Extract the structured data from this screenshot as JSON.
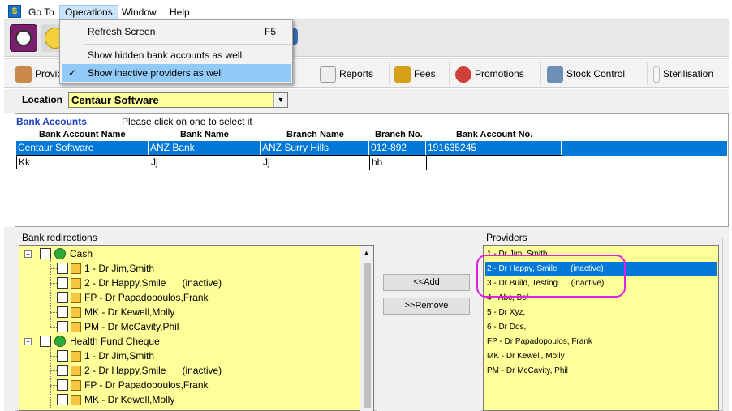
{
  "menu": {
    "goto": "Go To",
    "operations": "Operations",
    "window": "Window",
    "help": "Help"
  },
  "dropdown": {
    "refresh": "Refresh Screen",
    "refresh_shortcut": "F5",
    "show_hidden": "Show hidden bank accounts as well",
    "show_inactive": "Show inactive providers as well"
  },
  "toolbar": {
    "providers": "Provid",
    "reports": "Reports",
    "fees": "Fees",
    "promotions": "Promotions",
    "stock_control": "Stock Control",
    "sterilisation": "Sterilisation"
  },
  "location": {
    "label": "Location",
    "value": "Centaur Software"
  },
  "bank_accounts": {
    "title": "Bank Accounts",
    "hint": "Please click on one to select it",
    "columns": [
      "Bank Account Name",
      "Bank Name",
      "Branch Name",
      "Branch No.",
      "Bank Account No."
    ],
    "rows": [
      [
        "Centaur Software",
        "ANZ Bank",
        "ANZ Surry Hills",
        "012-892",
        "191635245"
      ],
      [
        "Kk",
        "Jj",
        "Jj",
        "hh",
        ""
      ]
    ]
  },
  "redirections": {
    "label": "Bank redirections",
    "groups": [
      {
        "name": "Cash",
        "items": [
          "1 - Dr Jim,Smith",
          "2 - Dr Happy,Smile      (inactive)",
          "FP - Dr Papadopoulos,Frank",
          "MK - Dr Kewell,Molly",
          "PM - Dr McCavity,Phil"
        ]
      },
      {
        "name": "Health Fund Cheque",
        "items": [
          "1 - Dr Jim,Smith",
          "2 - Dr Happy,Smile      (inactive)",
          "FP - Dr Papadopoulos,Frank",
          "MK - Dr Kewell,Molly"
        ]
      }
    ]
  },
  "buttons": {
    "add": "<<Add",
    "remove": ">>Remove"
  },
  "providers": {
    "label": "Providers",
    "items": [
      "1 - Dr Jim, Smith",
      "2 - Dr Happy, Smile      (inactive)",
      "3 - Dr Build, Testing      (inactive)",
      "4 - Abc, Bcf",
      "5 - Dr Xyz,",
      "6 - Dr Dds,",
      "FP - Dr Papadopoulos, Frank",
      "MK - Dr Kewell, Molly",
      "PM - Dr McCavity, Phil"
    ]
  },
  "colors": {
    "accent": "#0078d7",
    "list_bg": "#ffff99",
    "title_blue": "#1b3fbf",
    "highlight": "#e020e0"
  }
}
